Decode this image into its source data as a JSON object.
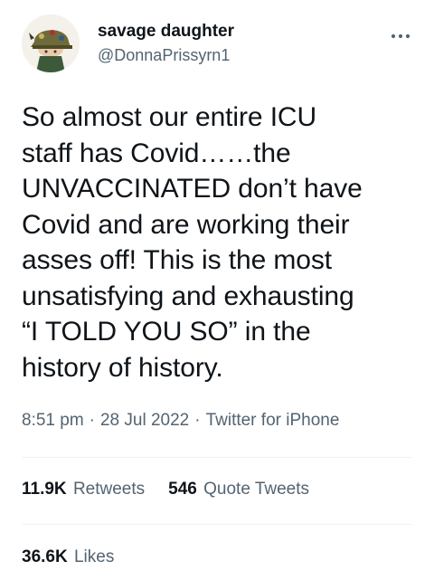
{
  "author": {
    "display_name": "savage daughter",
    "handle": "@DonnaPrissyrn1",
    "avatar_icon": "profile-avatar-icon"
  },
  "more_icon": "more-options-icon",
  "tweet": {
    "text": "So almost our entire ICU\nstaff has Covid……the\nUNVACCINATED don’t have\nCovid and are working their\nasses off!   This is the most\nunsatisfying and exhausting\n“I TOLD YOU SO” in the\nhistory of history.",
    "time": "8:51 pm",
    "date": "28 Jul 2022",
    "source": "Twitter for iPhone",
    "separator": "·"
  },
  "stats": {
    "retweets_count": "11.9K",
    "retweets_label": "Retweets",
    "quote_count": "546",
    "quote_label": "Quote Tweets",
    "likes_count": "36.6K",
    "likes_label": "Likes"
  },
  "colors": {
    "text_primary": "#0f1419",
    "text_secondary": "#536471",
    "divider": "#eff3f4"
  }
}
